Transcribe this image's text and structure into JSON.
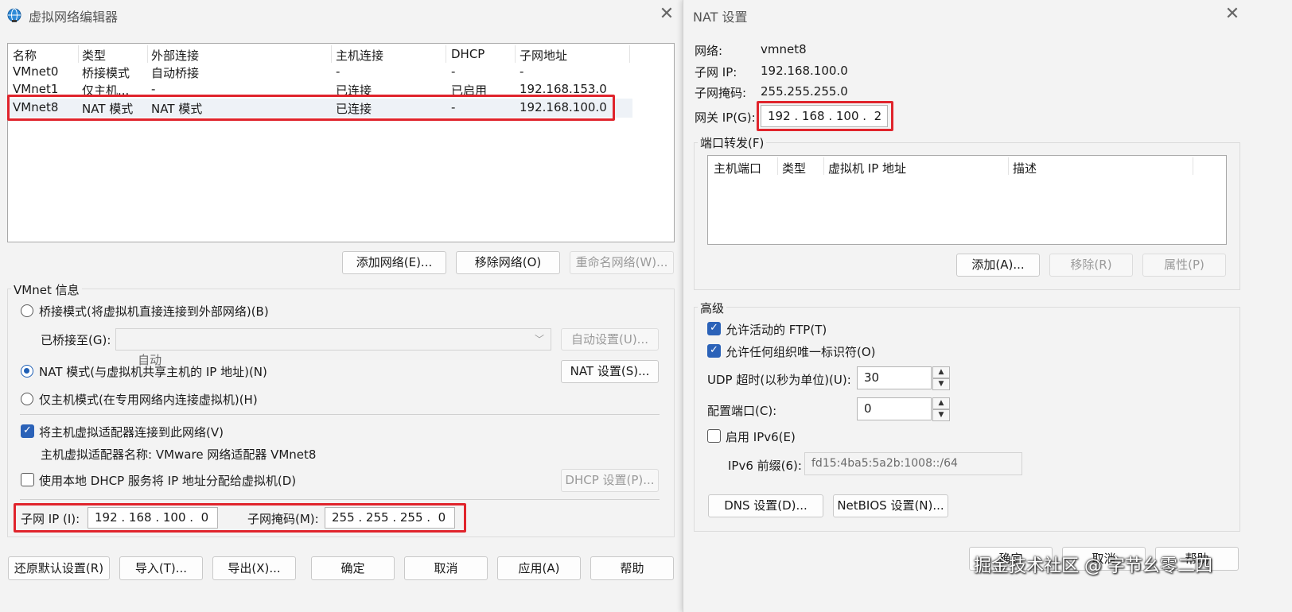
{
  "left_window": {
    "title": "虚拟网络编辑器",
    "columns": [
      "名称",
      "类型",
      "外部连接",
      "主机连接",
      "DHCP",
      "子网地址"
    ],
    "rows": [
      {
        "name": "VMnet0",
        "type": "桥接模式",
        "external": "自动桥接",
        "host": "-",
        "dhcp": "-",
        "subnet": "-"
      },
      {
        "name": "VMnet1",
        "type": "仅主机...",
        "external": "-",
        "host": "已连接",
        "dhcp": "已启用",
        "subnet": "192.168.153.0"
      },
      {
        "name": "VMnet8",
        "type": "NAT 模式",
        "external": "NAT 模式",
        "host": "已连接",
        "dhcp": "-",
        "subnet": "192.168.100.0"
      }
    ],
    "buttons": {
      "add_network": "添加网络(E)...",
      "remove_network": "移除网络(O)",
      "rename_network": "重命名网络(W)...",
      "auto_settings": "自动设置(U)...",
      "nat_settings": "NAT 设置(S)...",
      "dhcp_settings": "DHCP 设置(P)...",
      "restore_defaults": "还原默认设置(R)",
      "import": "导入(T)...",
      "export": "导出(X)...",
      "ok": "确定",
      "cancel": "取消",
      "apply": "应用(A)",
      "help": "帮助"
    },
    "vmnet_info": {
      "group_label": "VMnet 信息",
      "bridge_mode": "桥接模式(将虚拟机直接连接到外部网络)(B)",
      "bridged_to_label": "已桥接至(G):",
      "bridged_to_value": "自动",
      "nat_mode": "NAT 模式(与虚拟机共享主机的 IP 地址)(N)",
      "host_only_mode": "仅主机模式(在专用网络内连接虚拟机)(H)",
      "connect_adapter": "将主机虚拟适配器连接到此网络(V)",
      "adapter_name": "主机虚拟适配器名称: VMware 网络适配器 VMnet8",
      "use_dhcp": "使用本地 DHCP 服务将 IP 地址分配给虚拟机(D)",
      "subnet_ip_label": "子网 IP (I):",
      "subnet_ip_value": "192 . 168 . 100 .  0",
      "subnet_mask_label": "子网掩码(M):",
      "subnet_mask_value": "255 . 255 . 255 .  0"
    }
  },
  "nat_window": {
    "title": "NAT 设置",
    "network_label": "网络:",
    "network_value": "vmnet8",
    "subnet_ip_label": "子网 IP:",
    "subnet_ip_value": "192.168.100.0",
    "subnet_mask_label": "子网掩码:",
    "subnet_mask_value": "255.255.255.0",
    "gateway_label": "网关 IP(G):",
    "gateway_value": "192 . 168 . 100 .  2",
    "port_forwarding_label": "端口转发(F)",
    "pf_columns": [
      "主机端口",
      "类型",
      "虚拟机 IP 地址",
      "描述"
    ],
    "pf_add": "添加(A)...",
    "pf_remove": "移除(R)",
    "pf_properties": "属性(P)",
    "advanced_label": "高级",
    "allow_ftp": "允许活动的 FTP(T)",
    "allow_uid": "允许任何组织唯一标识符(O)",
    "udp_timeout_label": "UDP 超时(以秒为单位)(U):",
    "udp_timeout_value": "30",
    "config_port_label": "配置端口(C):",
    "config_port_value": "0",
    "enable_ipv6": "启用 IPv6(E)",
    "ipv6_prefix_label": "IPv6 前缀(6):",
    "ipv6_prefix_value": "fd15:4ba5:5a2b:1008::/64",
    "dns_settings": "DNS 设置(D)...",
    "netbios_settings": "NetBIOS 设置(N)...",
    "ok": "确定",
    "cancel": "取消",
    "help": "帮助"
  },
  "watermark": "掘金技术社区 @ 字节幺零二四",
  "colors": {
    "highlight": "#e0242c",
    "accent": "#2b62b8"
  }
}
